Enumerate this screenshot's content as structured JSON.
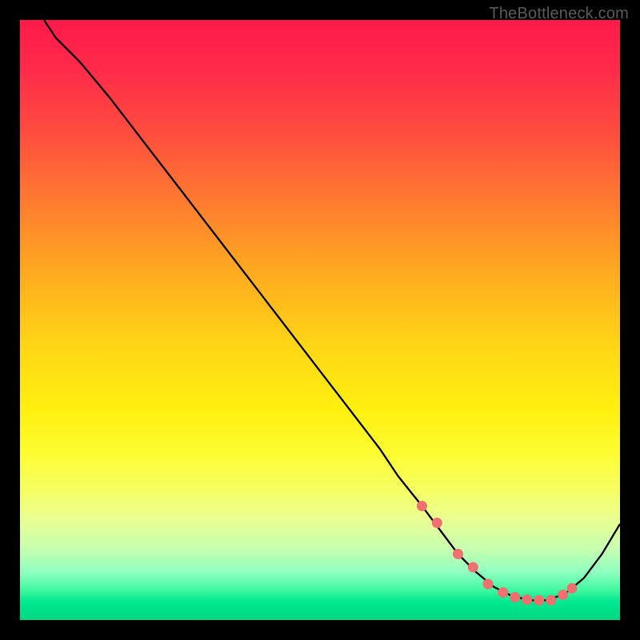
{
  "watermark": "TheBottleneck.com",
  "chart_data": {
    "type": "line",
    "title": "",
    "xlabel": "",
    "ylabel": "",
    "xlim": [
      0,
      100
    ],
    "ylim": [
      0,
      100
    ],
    "series": [
      {
        "name": "curve",
        "x": [
          4,
          6,
          10,
          15,
          20,
          25,
          30,
          35,
          40,
          45,
          50,
          55,
          60,
          63,
          67,
          70,
          73,
          76,
          79,
          82,
          85,
          88,
          91,
          94,
          97,
          100
        ],
        "y": [
          100,
          97,
          93,
          87,
          80.5,
          74,
          67.5,
          61,
          54.5,
          48,
          41.5,
          35,
          28.5,
          24,
          19,
          15,
          11,
          8,
          5.5,
          4,
          3.3,
          3.3,
          4.5,
          7,
          11,
          16
        ]
      }
    ],
    "markers": {
      "name": "dots",
      "x": [
        67,
        69.5,
        73,
        75.5,
        78,
        80.5,
        82.5,
        84.5,
        86.5,
        88.5,
        90.5,
        92
      ],
      "y": [
        19,
        16.2,
        11,
        8.8,
        6,
        4.6,
        3.8,
        3.4,
        3.3,
        3.3,
        4.2,
        5.3
      ]
    }
  }
}
